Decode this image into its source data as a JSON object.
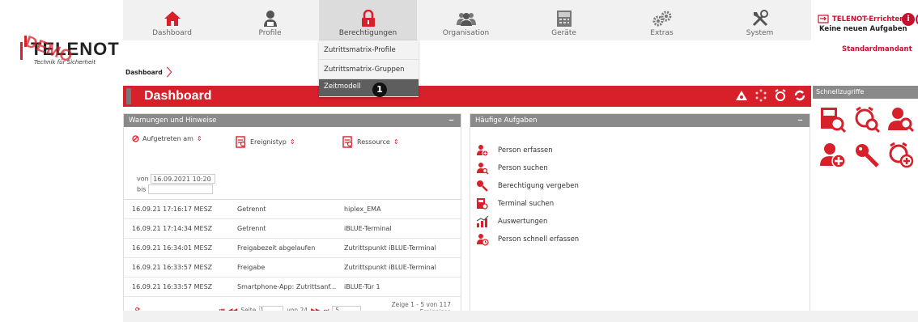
{
  "logo": {
    "brand": "TELENOT",
    "tagline": "Technik für Sicherheit",
    "watermark": "DEMO"
  },
  "nav": [
    {
      "label": "Dashboard",
      "icon": "home-icon"
    },
    {
      "label": "Profile",
      "icon": "user-profile-icon"
    },
    {
      "label": "Berechtigungen",
      "icon": "lock-icon"
    },
    {
      "label": "Organisation",
      "icon": "group-icon"
    },
    {
      "label": "Geräte",
      "icon": "terminal-icon"
    },
    {
      "label": "Extras",
      "icon": "gears-icon"
    },
    {
      "label": "System",
      "icon": "tools-icon"
    }
  ],
  "active_nav": "Berechtigungen",
  "topright": {
    "user": "TELENOT-Errichter",
    "tasks": "Keine neuen Aufgaben",
    "mandant": "Standardmandant"
  },
  "dropdown": {
    "items": [
      "Zutrittsmatrix-Profile",
      "Zutrittsmatrix-Gruppen",
      "Zeitmodell"
    ],
    "selected": "Zeitmodell",
    "badge": "1"
  },
  "breadcrumb": {
    "item": "Dashboard"
  },
  "page_title": "Dashboard",
  "quick_access": {
    "title": "Schnellzugriffe",
    "icons": [
      "terminal-search-icon",
      "alarm-clock-search-icon",
      "person-search-icon",
      "person-add-icon",
      "key-search-icon",
      "alarm-clock-add-icon"
    ]
  },
  "warnings": {
    "title": "Warnungen und Hinweise",
    "collapse": "−",
    "columns": [
      "Aufgetreten am",
      "Ereignistyp",
      "Ressource"
    ],
    "date_from_label": "von",
    "date_from_value": "16.09.2021 10:20",
    "date_to_label": "bis",
    "rows": [
      [
        "16.09.21 17:16:17 MESZ",
        "Getrennt",
        "hiplex_EMA"
      ],
      [
        "16.09.21 17:14:34 MESZ",
        "Getrennt",
        "iBLUE-Terminal"
      ],
      [
        "16.09.21 16:34:01 MESZ",
        "Freigabezeit abgelaufen",
        "Zutrittspunkt iBLUE-Terminal"
      ],
      [
        "16.09.21 16:33:57 MESZ",
        "Freigabe",
        "Zutrittspunkt iBLUE-Terminal"
      ],
      [
        "16.09.21 16:33:57 MESZ",
        "Smartphone-App: Zutrittsanf...",
        "iBLUE-Tür 1"
      ]
    ],
    "pager": {
      "page_label": "Seite",
      "page_value": "1",
      "of_label": "von 24",
      "page_size": "5",
      "summary_line1": "Zeige 1 - 5 von 117",
      "summary_line2": "Ereignisse"
    }
  },
  "tasks": {
    "title": "Häufige Aufgaben",
    "collapse": "−",
    "items": [
      {
        "label": "Person erfassen",
        "icon": "person-add-icon"
      },
      {
        "label": "Person suchen",
        "icon": "person-search-icon"
      },
      {
        "label": "Berechtigung vergeben",
        "icon": "key-icon"
      },
      {
        "label": "Terminal suchen",
        "icon": "terminal-search-icon"
      },
      {
        "label": "Auswertungen",
        "icon": "chart-icon"
      },
      {
        "label": "Person schnell erfassen",
        "icon": "person-quick-add-icon"
      }
    ]
  },
  "colors": {
    "accent": "#d8202a",
    "header_gray": "#8a8a8a",
    "nav_bg": "#f1f1f1"
  }
}
